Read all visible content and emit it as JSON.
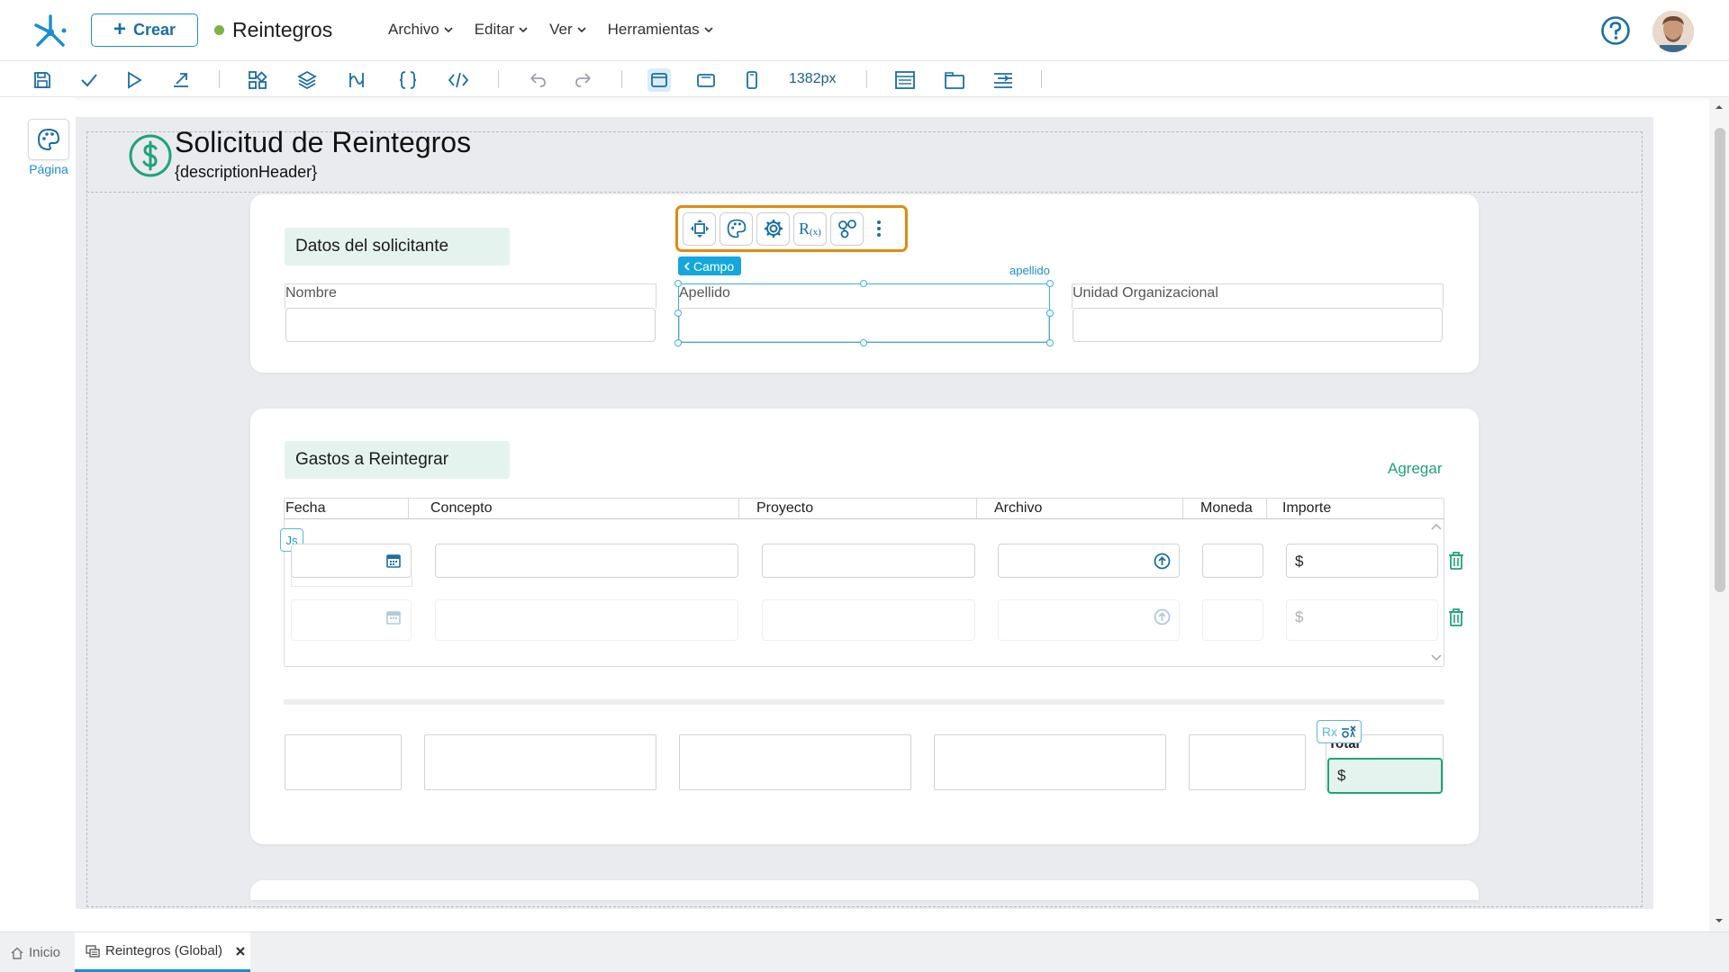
{
  "app": {
    "title": "Reintegros",
    "create_label": "Crear",
    "menu": [
      "Archivo",
      "Editar",
      "Ver",
      "Herramientas"
    ]
  },
  "toolbar": {
    "width_readout": "1382px"
  },
  "left_panel": {
    "pagina_label": "Página"
  },
  "form": {
    "title": "Solicitud de Reintegros",
    "subtitle": "{descriptionHeader}",
    "section1": {
      "title": "Datos del solicitante",
      "fields": [
        "Nombre",
        "Apellido",
        "Unidad Organizacional"
      ]
    },
    "selection": {
      "breadcrumb": "Campo",
      "field_name": "apellido"
    },
    "section2": {
      "title": "Gastos a Reintegrar",
      "add_label": "Agregar",
      "columns": [
        "Fecha",
        "Concepto",
        "Proyecto",
        "Archivo",
        "Moneda",
        "Importe"
      ],
      "currency_symbol": "$",
      "js_badge": "Js",
      "total_label": "Total",
      "total_value": "$",
      "rx_badge": "Rx"
    }
  },
  "bottom_tabs": [
    {
      "label": "Inicio"
    },
    {
      "label": "Reintegros (Global)"
    }
  ],
  "colors": {
    "accent": "#1a8fd0",
    "green": "#1fa37a",
    "selection_orange": "#e08a10"
  }
}
